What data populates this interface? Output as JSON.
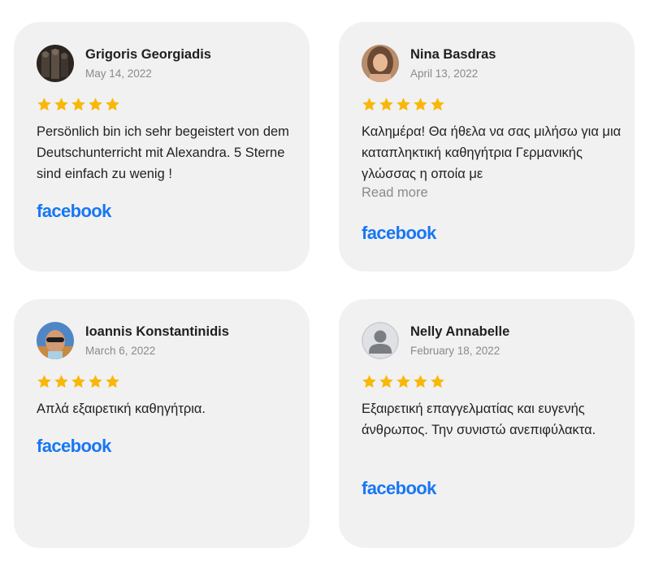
{
  "reviews": [
    {
      "name": "Grigoris Georgiadis",
      "date": "May 14, 2022",
      "rating": 5,
      "text": "Persönlich bin ich sehr begeistert von dem Deutschunterricht mit Alexandra. 5 Sterne sind einfach zu wenig !",
      "source": "facebook",
      "avatar": "user-photo"
    },
    {
      "name": "Nina Basdras",
      "date": "April 13, 2022",
      "rating": 5,
      "text": "Καλημέρα! Θα ήθελα να σας μιλήσω για μια καταπληκτική καθηγήτρια Γερμανικής γλώσσας η οποία με",
      "read_more": "Read more",
      "source": "facebook",
      "avatar": "user-photo"
    },
    {
      "name": "Ioannis Konstantinidis",
      "date": "March 6, 2022",
      "rating": 5,
      "text": "Απλά εξαιρετική καθηγήτρια.",
      "source": "facebook",
      "avatar": "user-photo"
    },
    {
      "name": "Nelly Annabelle",
      "date": "February 18, 2022",
      "rating": 5,
      "text": "Εξαιρετική επαγγελματίας και ευγενής άνθρωπος. Την συνιστώ ανεπιφύλακτα.",
      "source": "facebook",
      "avatar": "default-user-icon"
    }
  ],
  "colors": {
    "star": "#f9b707",
    "facebook": "#1877f2",
    "card_background": "#f1f1f2"
  }
}
